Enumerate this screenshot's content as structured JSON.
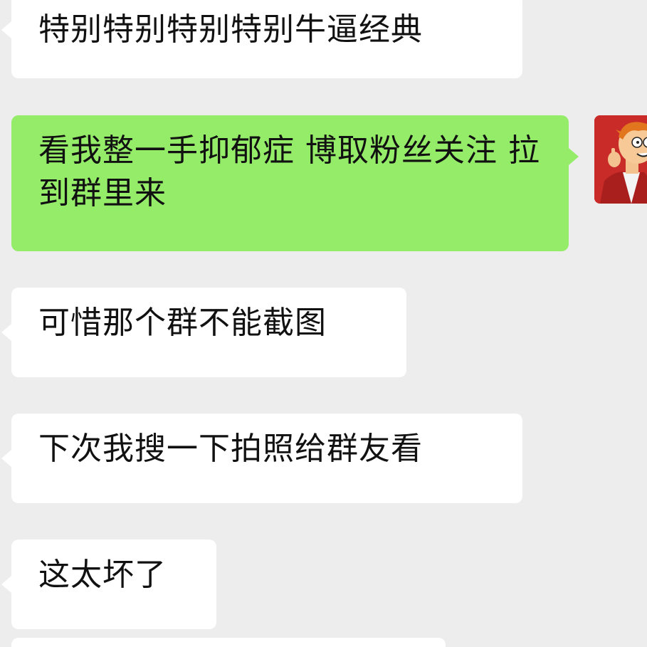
{
  "messages": [
    {
      "side": "in",
      "text": "特别特别特别特别牛逼经典"
    },
    {
      "side": "out",
      "text": "看我整一手抑郁症 博取粉丝关注 拉到群里来"
    },
    {
      "side": "in",
      "text": "可惜那个群不能截图"
    },
    {
      "side": "in",
      "text": "下次我搜一下拍照给群友看"
    },
    {
      "side": "in",
      "text": "这太坏了"
    }
  ],
  "colors": {
    "background": "#ededed",
    "incoming_bubble": "#ffffff",
    "outgoing_bubble": "#95ec69",
    "avatar_bg": "#c92b28"
  },
  "icons": {
    "self_avatar": "cartoon-avatar-icon"
  }
}
